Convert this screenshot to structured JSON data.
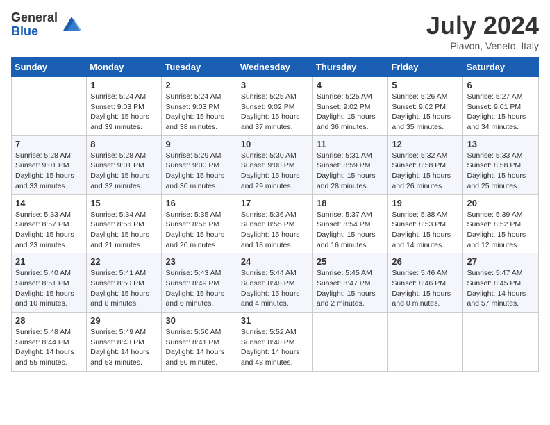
{
  "header": {
    "logo": {
      "general": "General",
      "blue": "Blue"
    },
    "title": "July 2024",
    "location": "Piavon, Veneto, Italy"
  },
  "weekdays": [
    "Sunday",
    "Monday",
    "Tuesday",
    "Wednesday",
    "Thursday",
    "Friday",
    "Saturday"
  ],
  "weeks": [
    [
      {
        "day": "",
        "info": ""
      },
      {
        "day": "1",
        "info": "Sunrise: 5:24 AM\nSunset: 9:03 PM\nDaylight: 15 hours\nand 39 minutes."
      },
      {
        "day": "2",
        "info": "Sunrise: 5:24 AM\nSunset: 9:03 PM\nDaylight: 15 hours\nand 38 minutes."
      },
      {
        "day": "3",
        "info": "Sunrise: 5:25 AM\nSunset: 9:02 PM\nDaylight: 15 hours\nand 37 minutes."
      },
      {
        "day": "4",
        "info": "Sunrise: 5:25 AM\nSunset: 9:02 PM\nDaylight: 15 hours\nand 36 minutes."
      },
      {
        "day": "5",
        "info": "Sunrise: 5:26 AM\nSunset: 9:02 PM\nDaylight: 15 hours\nand 35 minutes."
      },
      {
        "day": "6",
        "info": "Sunrise: 5:27 AM\nSunset: 9:01 PM\nDaylight: 15 hours\nand 34 minutes."
      }
    ],
    [
      {
        "day": "7",
        "info": "Sunrise: 5:28 AM\nSunset: 9:01 PM\nDaylight: 15 hours\nand 33 minutes."
      },
      {
        "day": "8",
        "info": "Sunrise: 5:28 AM\nSunset: 9:01 PM\nDaylight: 15 hours\nand 32 minutes."
      },
      {
        "day": "9",
        "info": "Sunrise: 5:29 AM\nSunset: 9:00 PM\nDaylight: 15 hours\nand 30 minutes."
      },
      {
        "day": "10",
        "info": "Sunrise: 5:30 AM\nSunset: 9:00 PM\nDaylight: 15 hours\nand 29 minutes."
      },
      {
        "day": "11",
        "info": "Sunrise: 5:31 AM\nSunset: 8:59 PM\nDaylight: 15 hours\nand 28 minutes."
      },
      {
        "day": "12",
        "info": "Sunrise: 5:32 AM\nSunset: 8:58 PM\nDaylight: 15 hours\nand 26 minutes."
      },
      {
        "day": "13",
        "info": "Sunrise: 5:33 AM\nSunset: 8:58 PM\nDaylight: 15 hours\nand 25 minutes."
      }
    ],
    [
      {
        "day": "14",
        "info": "Sunrise: 5:33 AM\nSunset: 8:57 PM\nDaylight: 15 hours\nand 23 minutes."
      },
      {
        "day": "15",
        "info": "Sunrise: 5:34 AM\nSunset: 8:56 PM\nDaylight: 15 hours\nand 21 minutes."
      },
      {
        "day": "16",
        "info": "Sunrise: 5:35 AM\nSunset: 8:56 PM\nDaylight: 15 hours\nand 20 minutes."
      },
      {
        "day": "17",
        "info": "Sunrise: 5:36 AM\nSunset: 8:55 PM\nDaylight: 15 hours\nand 18 minutes."
      },
      {
        "day": "18",
        "info": "Sunrise: 5:37 AM\nSunset: 8:54 PM\nDaylight: 15 hours\nand 16 minutes."
      },
      {
        "day": "19",
        "info": "Sunrise: 5:38 AM\nSunset: 8:53 PM\nDaylight: 15 hours\nand 14 minutes."
      },
      {
        "day": "20",
        "info": "Sunrise: 5:39 AM\nSunset: 8:52 PM\nDaylight: 15 hours\nand 12 minutes."
      }
    ],
    [
      {
        "day": "21",
        "info": "Sunrise: 5:40 AM\nSunset: 8:51 PM\nDaylight: 15 hours\nand 10 minutes."
      },
      {
        "day": "22",
        "info": "Sunrise: 5:41 AM\nSunset: 8:50 PM\nDaylight: 15 hours\nand 8 minutes."
      },
      {
        "day": "23",
        "info": "Sunrise: 5:43 AM\nSunset: 8:49 PM\nDaylight: 15 hours\nand 6 minutes."
      },
      {
        "day": "24",
        "info": "Sunrise: 5:44 AM\nSunset: 8:48 PM\nDaylight: 15 hours\nand 4 minutes."
      },
      {
        "day": "25",
        "info": "Sunrise: 5:45 AM\nSunset: 8:47 PM\nDaylight: 15 hours\nand 2 minutes."
      },
      {
        "day": "26",
        "info": "Sunrise: 5:46 AM\nSunset: 8:46 PM\nDaylight: 15 hours\nand 0 minutes."
      },
      {
        "day": "27",
        "info": "Sunrise: 5:47 AM\nSunset: 8:45 PM\nDaylight: 14 hours\nand 57 minutes."
      }
    ],
    [
      {
        "day": "28",
        "info": "Sunrise: 5:48 AM\nSunset: 8:44 PM\nDaylight: 14 hours\nand 55 minutes."
      },
      {
        "day": "29",
        "info": "Sunrise: 5:49 AM\nSunset: 8:43 PM\nDaylight: 14 hours\nand 53 minutes."
      },
      {
        "day": "30",
        "info": "Sunrise: 5:50 AM\nSunset: 8:41 PM\nDaylight: 14 hours\nand 50 minutes."
      },
      {
        "day": "31",
        "info": "Sunrise: 5:52 AM\nSunset: 8:40 PM\nDaylight: 14 hours\nand 48 minutes."
      },
      {
        "day": "",
        "info": ""
      },
      {
        "day": "",
        "info": ""
      },
      {
        "day": "",
        "info": ""
      }
    ]
  ]
}
